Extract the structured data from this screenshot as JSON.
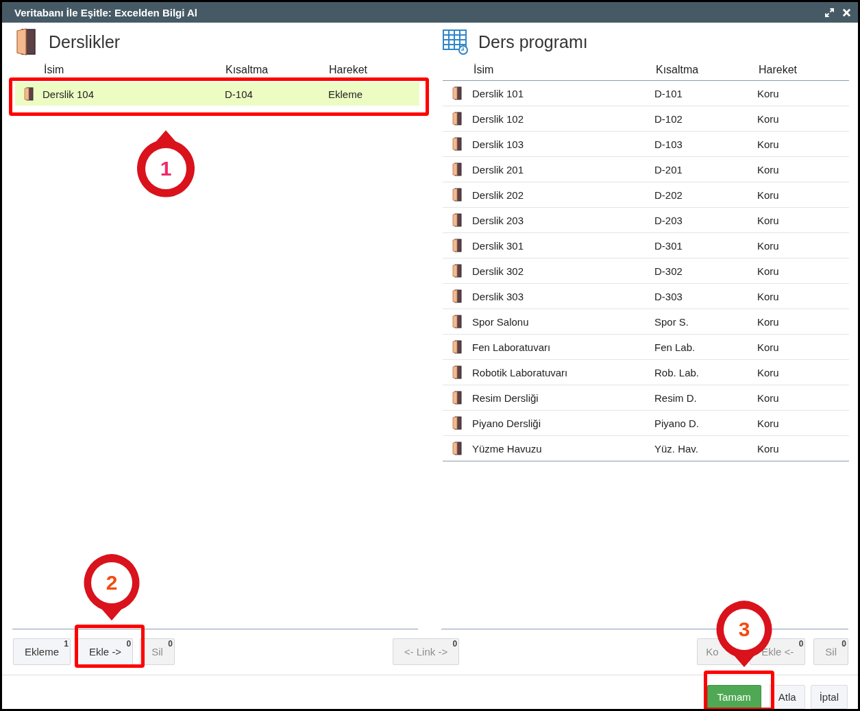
{
  "window": {
    "title": "Veritabanı İle Eşitle: Excelden Bilgi Al"
  },
  "left_panel": {
    "title": "Derslikler",
    "columns": [
      "İsim",
      "Kısaltma",
      "Hareket"
    ],
    "rows": [
      {
        "name": "Derslik 104",
        "short": "D-104",
        "action": "Ekleme",
        "selected": true
      }
    ]
  },
  "right_panel": {
    "title": "Ders programı",
    "columns": [
      "İsim",
      "Kısaltma",
      "Hareket"
    ],
    "rows": [
      {
        "name": "Derslik 101",
        "short": "D-101",
        "action": "Koru",
        "selected": false
      },
      {
        "name": "Derslik 102",
        "short": "D-102",
        "action": "Koru",
        "selected": false
      },
      {
        "name": "Derslik 103",
        "short": "D-103",
        "action": "Koru",
        "selected": false
      },
      {
        "name": "Derslik 201",
        "short": "D-201",
        "action": "Koru",
        "selected": false
      },
      {
        "name": "Derslik 202",
        "short": "D-202",
        "action": "Koru",
        "selected": false
      },
      {
        "name": "Derslik 203",
        "short": "D-203",
        "action": "Koru",
        "selected": false
      },
      {
        "name": "Derslik 301",
        "short": "D-301",
        "action": "Koru",
        "selected": false
      },
      {
        "name": "Derslik 302",
        "short": "D-302",
        "action": "Koru",
        "selected": false
      },
      {
        "name": "Derslik 303",
        "short": "D-303",
        "action": "Koru",
        "selected": false
      },
      {
        "name": "Spor Salonu",
        "short": "Spor S.",
        "action": "Koru",
        "selected": false
      },
      {
        "name": "Fen Laboratuvarı",
        "short": "Fen Lab.",
        "action": "Koru",
        "selected": false
      },
      {
        "name": "Robotik Laboratuvarı",
        "short": "Rob. Lab.",
        "action": "Koru",
        "selected": false
      },
      {
        "name": "Resim Dersliği",
        "short": "Resim D.",
        "action": "Koru",
        "selected": false
      },
      {
        "name": "Piyano Dersliği",
        "short": "Piyano D.",
        "action": "Koru",
        "selected": false
      },
      {
        "name": "Yüzme Havuzu",
        "short": "Yüz. Hav.",
        "action": "Koru",
        "selected": false
      }
    ]
  },
  "left_buttons": [
    {
      "label": "Ekleme",
      "count": "1",
      "disabled": false
    },
    {
      "label": "Ekle ->",
      "count": "0",
      "disabled": false
    },
    {
      "label": "Sil",
      "count": "0",
      "disabled": true
    }
  ],
  "center_button": {
    "label": "<- Link ->",
    "count": "0",
    "disabled": true
  },
  "right_buttons": [
    {
      "label": "Ko",
      "disabled": true
    },
    {
      "label": "Ekle <-",
      "count": "0",
      "disabled": true
    },
    {
      "label": "Sil",
      "count": "0",
      "disabled": true
    }
  ],
  "footer_buttons": [
    {
      "label": "Tamam",
      "kind": "primary"
    },
    {
      "label": "Atla",
      "kind": "default"
    },
    {
      "label": "İptal",
      "kind": "default"
    }
  ],
  "annotations": [
    {
      "label": "1"
    },
    {
      "label": "2"
    },
    {
      "label": "3"
    }
  ]
}
